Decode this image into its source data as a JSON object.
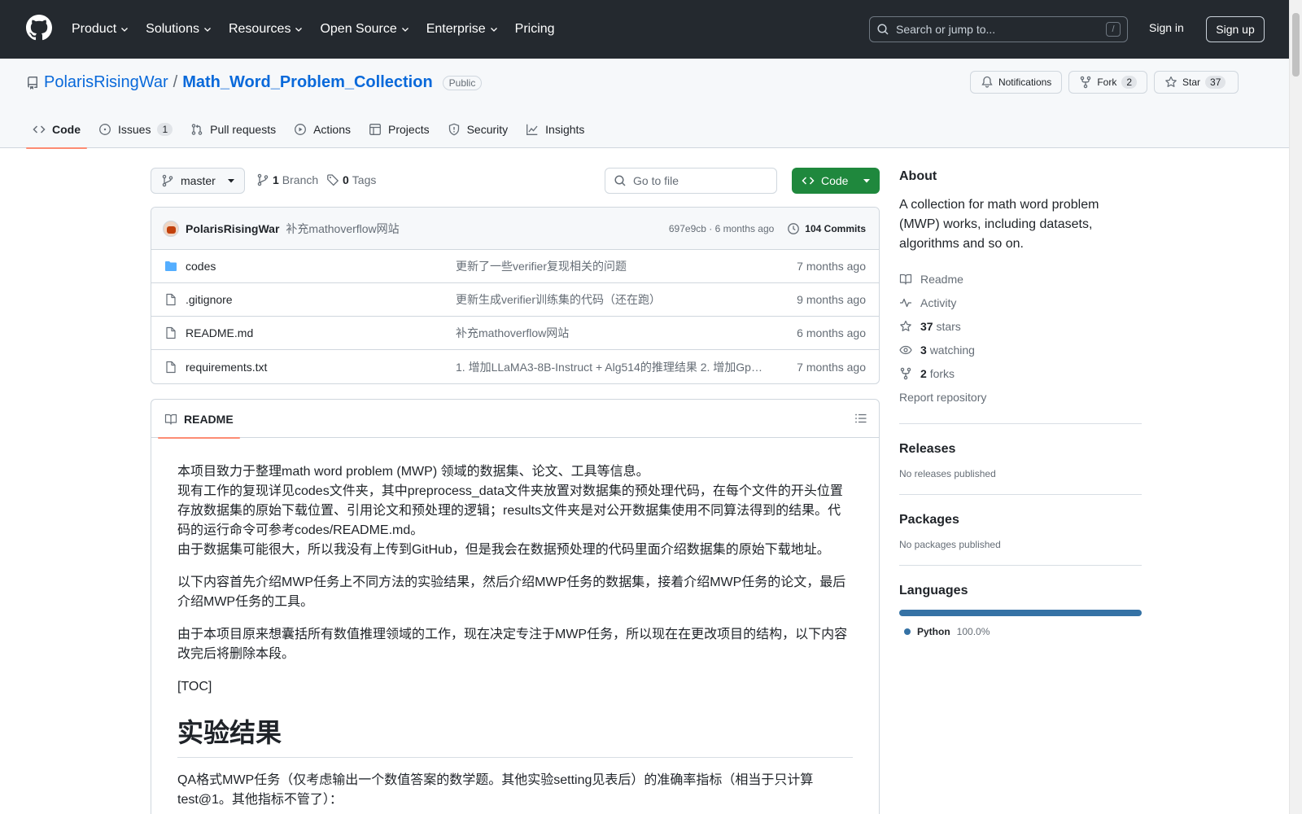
{
  "topnav": {
    "items": [
      {
        "label": "Product",
        "dropdown": true
      },
      {
        "label": "Solutions",
        "dropdown": true
      },
      {
        "label": "Resources",
        "dropdown": true
      },
      {
        "label": "Open Source",
        "dropdown": true
      },
      {
        "label": "Enterprise",
        "dropdown": true
      },
      {
        "label": "Pricing",
        "dropdown": false
      }
    ],
    "search_placeholder": "Search or jump to...",
    "search_shortcut": "/",
    "sign_in": "Sign in",
    "sign_up": "Sign up"
  },
  "repo": {
    "owner": "PolarisRisingWar",
    "separator": "/",
    "name": "Math_Word_Problem_Collection",
    "visibility": "Public",
    "notifications_label": "Notifications",
    "fork_label": "Fork",
    "fork_count": "2",
    "star_label": "Star",
    "star_count": "37"
  },
  "tabs": [
    {
      "label": "Code",
      "icon": "code-icon",
      "active": true
    },
    {
      "label": "Issues",
      "icon": "issue-icon",
      "count": "1"
    },
    {
      "label": "Pull requests",
      "icon": "pull-request-icon"
    },
    {
      "label": "Actions",
      "icon": "play-icon"
    },
    {
      "label": "Projects",
      "icon": "table-icon"
    },
    {
      "label": "Security",
      "icon": "shield-icon"
    },
    {
      "label": "Insights",
      "icon": "graph-icon"
    }
  ],
  "toolbar": {
    "branch": "master",
    "branch_count": "1",
    "branch_label": "Branch",
    "tag_count": "0",
    "tag_label": "Tags",
    "goto_file": "Go to file",
    "code_button": "Code"
  },
  "commit": {
    "author": "PolarisRisingWar",
    "message": "补充mathoverflow网站",
    "hash_time": "697e9cb · 6 months ago",
    "commits": "104 Commits"
  },
  "files": [
    {
      "name": "codes",
      "type": "folder",
      "message": "更新了一些verifier复现相关的问题",
      "time": "7 months ago"
    },
    {
      "name": ".gitignore",
      "type": "file",
      "message": "更新生成verifier训练集的代码（还在跑）",
      "time": "9 months ago"
    },
    {
      "name": "README.md",
      "type": "file",
      "message": "补充mathoverflow网站",
      "time": "6 months ago"
    },
    {
      "name": "requirements.txt",
      "type": "file",
      "message": "1. 增加LLaMA3-8B-Instruct + Alg514的推理结果 2. 增加Gp…",
      "time": "7 months ago"
    }
  ],
  "readme": {
    "tab_label": "README",
    "p1_l1": "本项目致力于整理math word problem (MWP) 领域的数据集、论文、工具等信息。",
    "p1_l2": "现有工作的复现详见codes文件夹，其中preprocess_data文件夹放置对数据集的预处理代码，在每个文件的开头位置存放数据集的原始下载位置、引用论文和预处理的逻辑；results文件夹是对公开数据集使用不同算法得到的结果。代码的运行命令可参考codes/README.md。",
    "p1_l3": "由于数据集可能很大，所以我没有上传到GitHub，但是我会在数据预处理的代码里面介绍数据集的原始下载地址。",
    "p2": "以下内容首先介绍MWP任务上不同方法的实验结果，然后介绍MWP任务的数据集，接着介绍MWP任务的论文，最后介绍MWP任务的工具。",
    "p3": "由于本项目原来想囊括所有数值推理领域的工作，现在决定专注于MWP任务，所以现在在更改项目的结构，以下内容改完后将删除本段。",
    "p4": "[TOC]",
    "h1": "实验结果",
    "p5": "QA格式MWP任务（仅考虑输出一个数值答案的数学题。其他实验setting见表后）的准确率指标（相当于只计算test@1。其他指标不管了）："
  },
  "about": {
    "title": "About",
    "description": "A collection for math word problem (MWP) works, including datasets, algorithms and so on.",
    "readme": "Readme",
    "activity": "Activity",
    "stars_count": "37",
    "stars_label": "stars",
    "watching_count": "3",
    "watching_label": "watching",
    "forks_count": "2",
    "forks_label": "forks",
    "report": "Report repository"
  },
  "releases": {
    "title": "Releases",
    "note": "No releases published"
  },
  "packages": {
    "title": "Packages",
    "note": "No packages published"
  },
  "languages": {
    "title": "Languages",
    "items": [
      {
        "name": "Python",
        "percent": "100.0%",
        "color": "#3572a5"
      }
    ]
  },
  "colors": {
    "header_bg": "#24292f",
    "link": "#0969da",
    "primary_button": "#1f883d",
    "active_tab_underline": "#fd8c73"
  }
}
